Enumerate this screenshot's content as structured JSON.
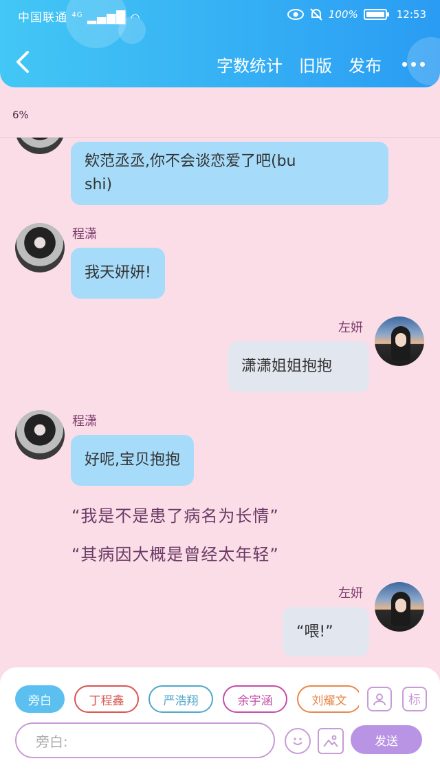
{
  "status_bar": {
    "carrier": "中国联通",
    "network": "4G",
    "battery": "100%",
    "time": "12:53"
  },
  "nav": {
    "word_count": "字数统计",
    "old_version": "旧版",
    "publish": "发布"
  },
  "progress": "6%",
  "messages": [
    {
      "side": "left",
      "text_line1": "欸范丞丞,你不会谈恋爱了吧(bu",
      "text_line2": "shi)"
    },
    {
      "side": "left",
      "name": "程潇",
      "text": "我天妍妍!"
    },
    {
      "side": "right",
      "name": "左妍",
      "text": "潇潇姐姐抱抱"
    },
    {
      "side": "left",
      "name": "程潇",
      "text": "好呢,宝贝抱抱"
    },
    {
      "type": "narration",
      "text": "“我是不是患了病名为长情”"
    },
    {
      "type": "narration",
      "text": "“其病因大概是曾经太年轻”"
    },
    {
      "side": "right",
      "name": "左妍",
      "text": "“喂!”"
    }
  ],
  "roles": [
    {
      "label": "旁白",
      "color": "#5bc0f0",
      "active": true
    },
    {
      "label": "丁程鑫",
      "color": "#d9534f",
      "active": false
    },
    {
      "label": "严浩翔",
      "color": "#4fa7c9",
      "active": false
    },
    {
      "label": "余宇涵",
      "color": "#c64ba8",
      "active": false
    },
    {
      "label": "刘耀文",
      "color": "#e8874a",
      "active": false
    }
  ],
  "input": {
    "placeholder": "旁白:",
    "send": "发送",
    "tag_icon_label": "标"
  },
  "colors": {
    "header_gradient": [
      "#43c7f5",
      "#2a9cf3"
    ],
    "background": "#fbdde8",
    "bubble_left": "#a6dcfa",
    "bubble_right": "#e2e6ee",
    "send_button": "#b994e4",
    "accent_outline": "#c79bd6"
  },
  "icons": [
    "back-chevron-icon",
    "more-dots-icon",
    "eye-icon",
    "mute-bell-icon",
    "wifi-icon",
    "signal-icon",
    "battery-icon",
    "person-card-icon",
    "tag-icon",
    "emoji-icon",
    "image-icon"
  ]
}
